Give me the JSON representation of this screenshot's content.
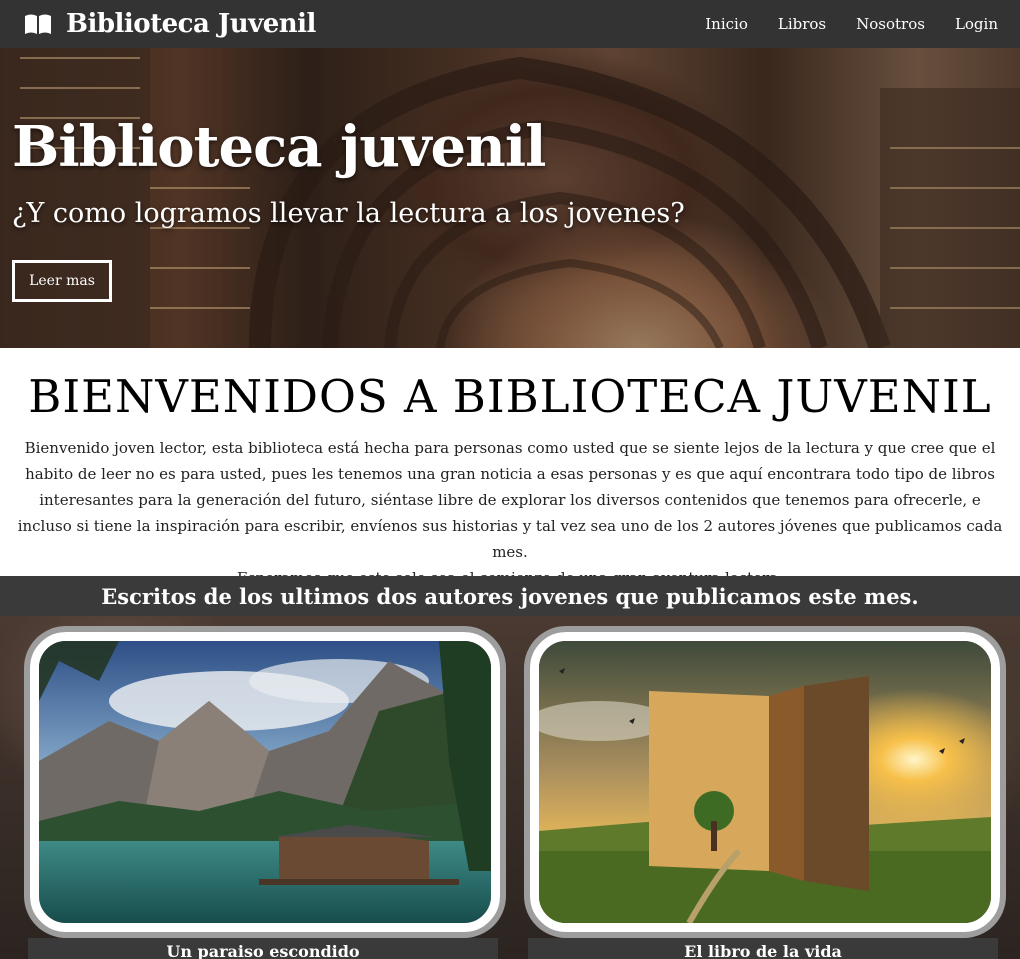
{
  "navbar": {
    "brand": "Biblioteca Juvenil",
    "brand_icon": "open-book-icon",
    "links": [
      "Inicio",
      "Libros",
      "Nosotros",
      "Login"
    ]
  },
  "hero": {
    "title": "Biblioteca juvenil",
    "subtitle": "¿Y como logramos llevar la lectura a los jovenes?",
    "button": "Leer mas"
  },
  "welcome": {
    "title": "BIENVENIDOS A BIBLIOTECA JUVENIL",
    "text": "Bienvenido joven lector, esta biblioteca está hecha para personas como usted que se siente lejos de la lectura y que cree que el habito de leer no es para usted, pues les tenemos una gran noticia a esas personas y es que aquí encontrara todo tipo de libros interesantes para la generación del futuro, siéntase libre de explorar los diversos contenidos que tenemos para ofrecerle, e incluso si tiene la inspiración para escribir, envíenos sus historias y tal vez sea uno de los 2 autores jóvenes que publicamos cada mes.",
    "text2": "Esperamos que esto solo sea el comienzo de una gran aventura lectora."
  },
  "writings": {
    "title": "Escritos de los ultimos dos autores jovenes que publicamos este mes.",
    "cards": [
      {
        "label": "Un paraiso escondido"
      },
      {
        "label": "El libro de la vida"
      }
    ]
  },
  "colors": {
    "navbar": "#333333",
    "section_bar": "#3a3a3a",
    "card_border": "#ffffff"
  }
}
